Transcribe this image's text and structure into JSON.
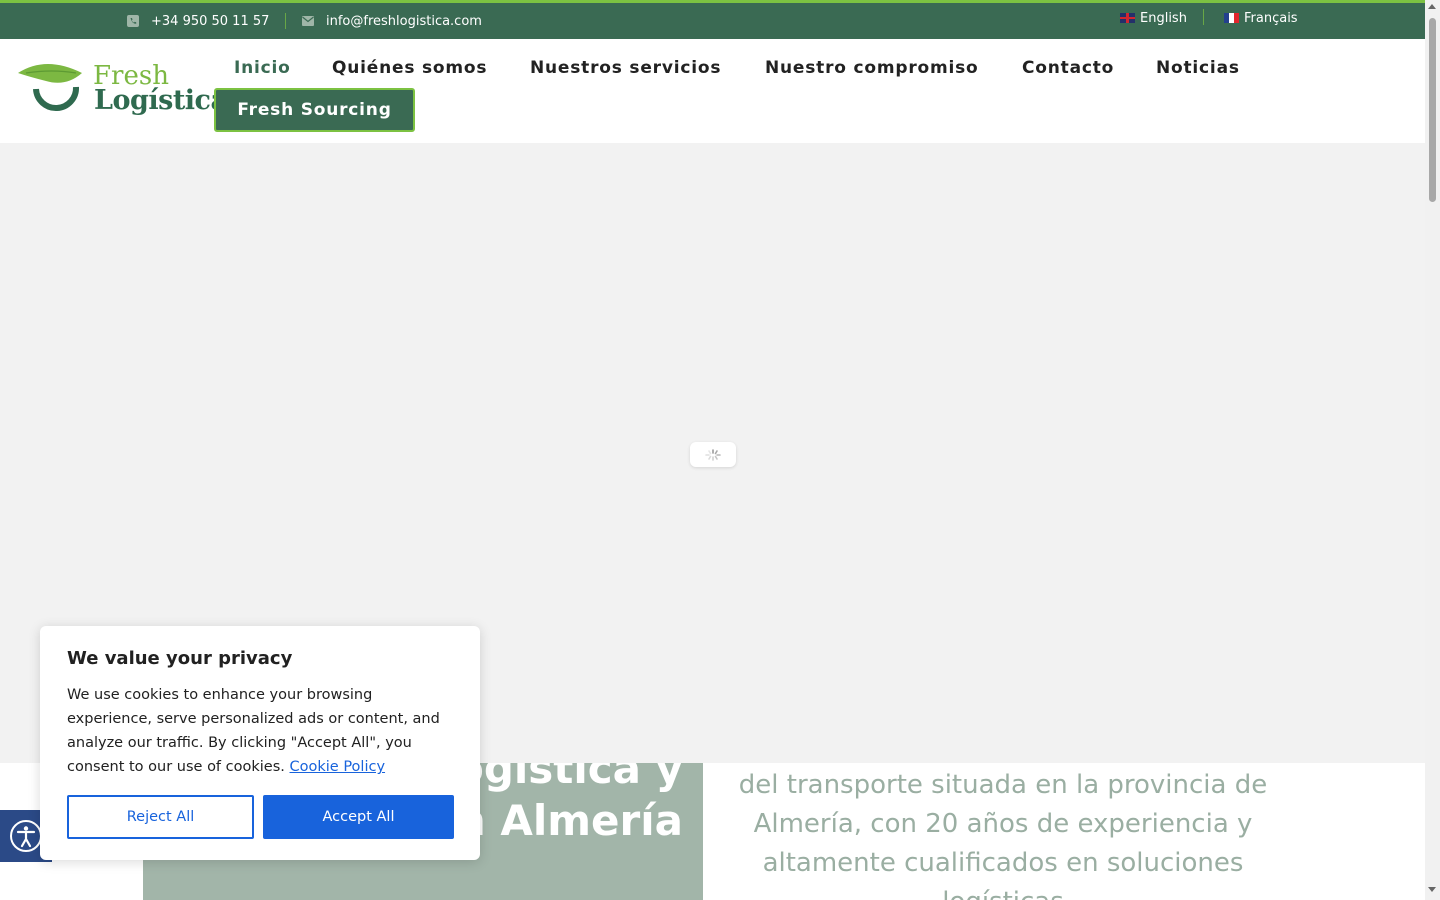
{
  "topbar": {
    "phone": "+34 950 50 11 57",
    "email": "info@freshlogistica.com",
    "languages": [
      {
        "label": "English",
        "flag": "uk-flag-icon"
      },
      {
        "label": "Français",
        "flag": "fr-flag-icon"
      }
    ]
  },
  "logo": {
    "line1": "Fresh",
    "line2": "Logística"
  },
  "nav": {
    "items": [
      "Inicio",
      "Quiénes somos",
      "Nuestros servicios",
      "Nuestro compromiso",
      "Contacto",
      "Noticias"
    ],
    "cta": "Fresh Sourcing"
  },
  "hero": {
    "title_line1": "Logística y",
    "title_line2": "transporte en Almería",
    "text": "del transporte situada en la provincia de Almería, con 20 años de experiencia y altamente cualificados en soluciones logísticas"
  },
  "cookie": {
    "title": "We value your privacy",
    "text": "We use cookies to enhance your browsing experience, serve personalized ads or content, and analyze our traffic. By clicking \"Accept All\", you consent to our use of cookies.",
    "policy_link": "Cookie Policy",
    "reject": "Reject All",
    "accept": "Accept All"
  },
  "colors": {
    "brand_green_dark": "#3a6a53",
    "brand_green_light": "#7cc242",
    "cookie_blue": "#1863dc",
    "a11y_blue": "#2b4a87"
  }
}
